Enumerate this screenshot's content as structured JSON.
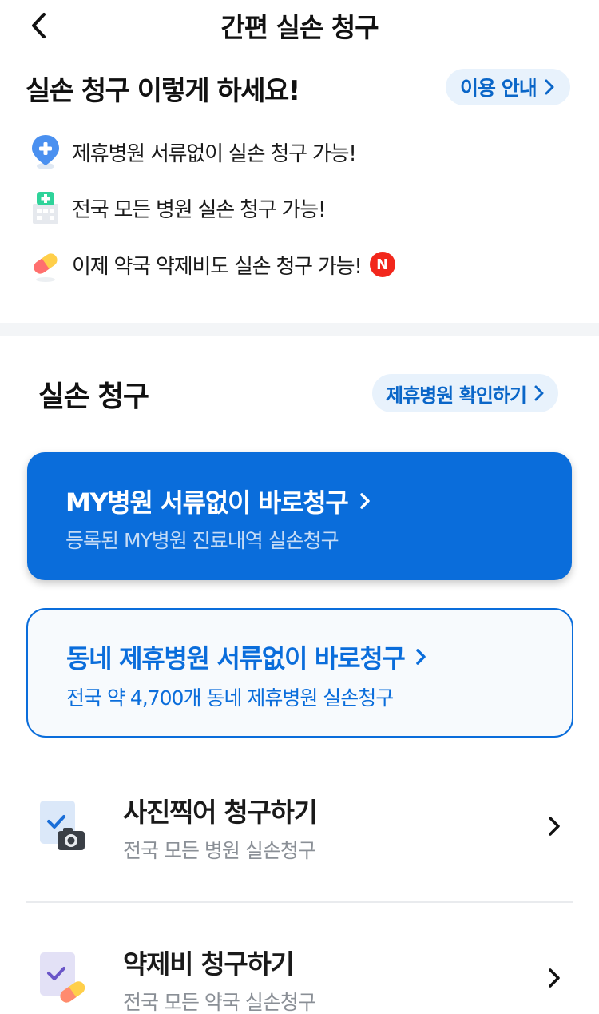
{
  "header": {
    "title": "간편 실손 청구",
    "back_icon": "chevron-left-icon"
  },
  "guide": {
    "title": "실손 청구 이렇게 하세요!",
    "usage_button": "이용 안내",
    "features": [
      {
        "icon": "location-pin-plus-icon",
        "text": "제휴병원 서류없이 실손 청구 가능!"
      },
      {
        "icon": "hospital-building-icon",
        "text": "전국 모든 병원 실손 청구 가능!"
      },
      {
        "icon": "pill-capsule-icon",
        "text": "이제 약국 약제비도 실손 청구 가능!",
        "badge": "N"
      }
    ]
  },
  "claims": {
    "title": "실손 청구",
    "partner_button": "제휴병원 확인하기",
    "my_card": {
      "title": "MY병원 서류없이 바로청구",
      "subtitle": "등록된 MY병원 진료내역 실손청구"
    },
    "local_card": {
      "title": "동네 제휴병원 서류없이 바로청구",
      "subtitle": "전국 약 4,700개 동네 제휴병원 실손청구"
    },
    "rows": [
      {
        "icon": "camera-document-icon",
        "title": "사진찍어 청구하기",
        "subtitle": "전국 모든 병원 실손청구"
      },
      {
        "icon": "pill-document-icon",
        "title": "약제비 청구하기",
        "subtitle": "전국 모든 약국 실손청구"
      }
    ]
  },
  "colors": {
    "primary": "#0a6ddb",
    "pill_bg": "#e8f2fc",
    "badge": "#f2271c",
    "subtext": "#8a8f96"
  }
}
